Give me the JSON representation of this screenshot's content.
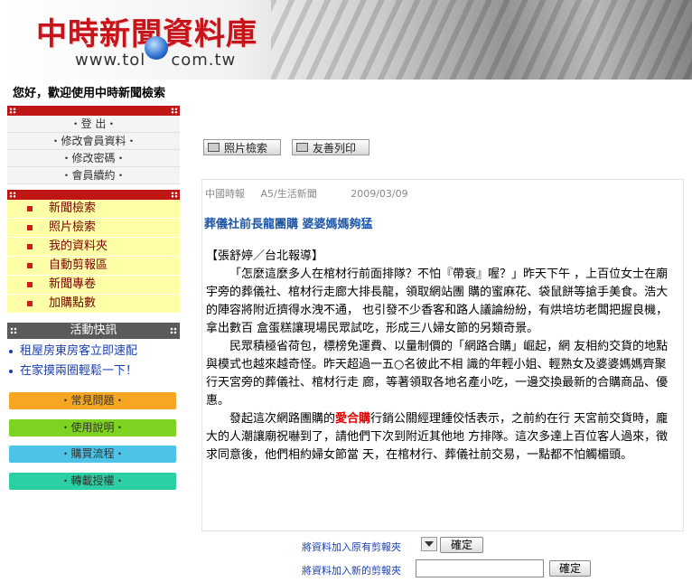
{
  "header": {
    "title": "中時新聞資料庫",
    "url": "www.tol",
    "url_suffix": "com.tw"
  },
  "welcome": "您好，歡迎使用中時新聞檢索",
  "member_menu": [
    "・登 出・",
    "・修改會員資料・",
    "・修改密碼・",
    "・會員續約・"
  ],
  "nav_menu": [
    "新聞檢索",
    "照片檢索",
    "我的資料夾",
    "自動剪報區",
    "新聞專卷",
    "加購點數"
  ],
  "events": {
    "title": "活動快訊",
    "items": [
      "租屋房東房客立即速配",
      "在家摸兩圈輕鬆一下！"
    ]
  },
  "color_buttons": [
    {
      "label": "・常見問題・",
      "color": "#f5a623"
    },
    {
      "label": "・使用說明・",
      "color": "#7ed321"
    },
    {
      "label": "・購買流程・",
      "color": "#4dc3e8"
    },
    {
      "label": "・轉載授權・",
      "color": "#2bcfa3"
    }
  ],
  "toolbar": {
    "photo_search": "照片檢索",
    "print": "友善列印"
  },
  "article": {
    "source": "中國時報",
    "section": "A5/生活新聞",
    "date": "2009/03/09",
    "headline": "葬儀社前長龍團購 婆婆媽媽夠猛",
    "byline": "【張舒婷／台北報導】",
    "p1": "「怎麼這麼多人在棺材行前面排隊？不怕『帶衰』喔？」昨天下午 ，上百位女士在廟宇旁的葬儀社、棺材行走廊大排長龍，領取網站團 購的蜜麻花、袋鼠餅等搶手美食。浩大的陣容將附近擠得水洩不通， 也引發不少香客和路人議論紛紛，有烘培坊老闆把握良機，拿出數百 盒蛋糕讓現場民眾試吃，形成三八婦女節的另類奇景。",
    "p2": "民眾積極省荷包，標榜免運費、以量制價的「網路合購」崛起，網 友相約交貨的地點與模式也越來越奇怪。昨天超過一五○名彼此不相 識的年輕小姐、輕熟女及婆婆媽媽齊聚行天宮旁的葬儀社、棺材行走 廊，等著領取各地名產小吃，一邊交換最新的合購商品、優惠。",
    "p3_before": "發起這次網路團購的",
    "p3_highlight": "愛合購",
    "p3_after": "行銷公關經理鍾佼恬表示，之前約在行 天宮前交貨時，龐大的人潮讓廟祝嚇到了，請他們下次到附近其他地 方排隊。這次多達上百位客人過來，徵求同意後，他們相約婦女節當 天，在棺材行、葬儀社前交易，一點都不怕觸楣頭。"
  },
  "clip": {
    "existing_label": "將資料加入原有剪報夾",
    "new_label": "將資料加入新的剪報夾",
    "confirm": "確定",
    "new_value": ""
  }
}
